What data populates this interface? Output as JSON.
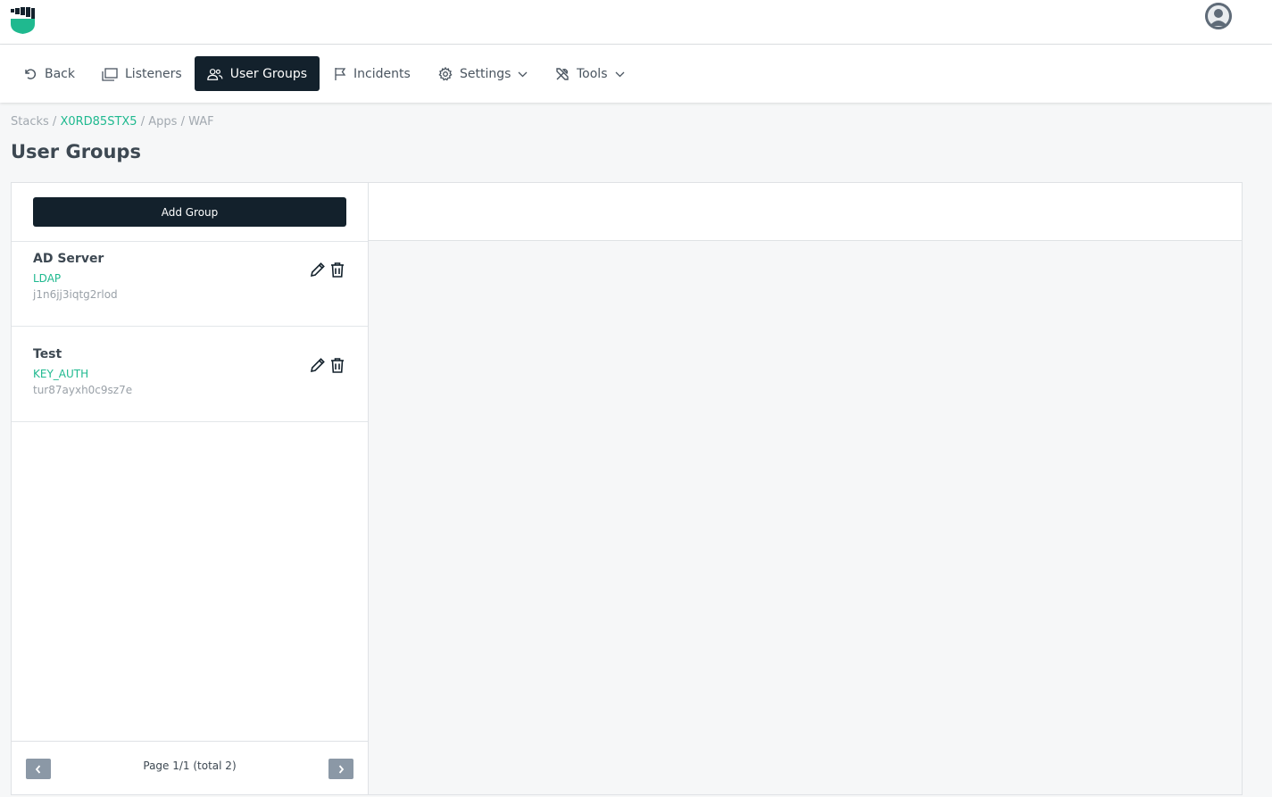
{
  "app": {
    "brand_color": "#1fb98f",
    "dark_color": "#13212c"
  },
  "nav": {
    "back": "Back",
    "listeners": "Listeners",
    "user_groups": "User Groups",
    "incidents": "Incidents",
    "settings": "Settings",
    "tools": "Tools"
  },
  "breadcrumb": {
    "stacks": "Stacks",
    "sep": "/",
    "stack_id": "X0RD85STX5",
    "apps": "Apps",
    "waf": "WAF"
  },
  "page": {
    "title": "User Groups"
  },
  "panel": {
    "add_button": "Add Group",
    "groups": [
      {
        "name": "AD Server",
        "type": "LDAP",
        "id": "j1n6jj3iqtg2rlod"
      },
      {
        "name": "Test",
        "type": "KEY_AUTH",
        "id": "tur87ayxh0c9sz7e"
      }
    ],
    "pagination": {
      "text": "Page 1/1 (total 2)"
    }
  },
  "icons": {
    "logo": "fist-shield-logo",
    "avatar": "user-avatar-icon",
    "back": "undo-icon",
    "listeners": "windows-icon",
    "user_groups": "users-icon",
    "incidents": "flag-icon",
    "settings": "gear-icon",
    "tools": "tools-icon",
    "edit": "pencil-icon",
    "delete": "trash-icon"
  }
}
